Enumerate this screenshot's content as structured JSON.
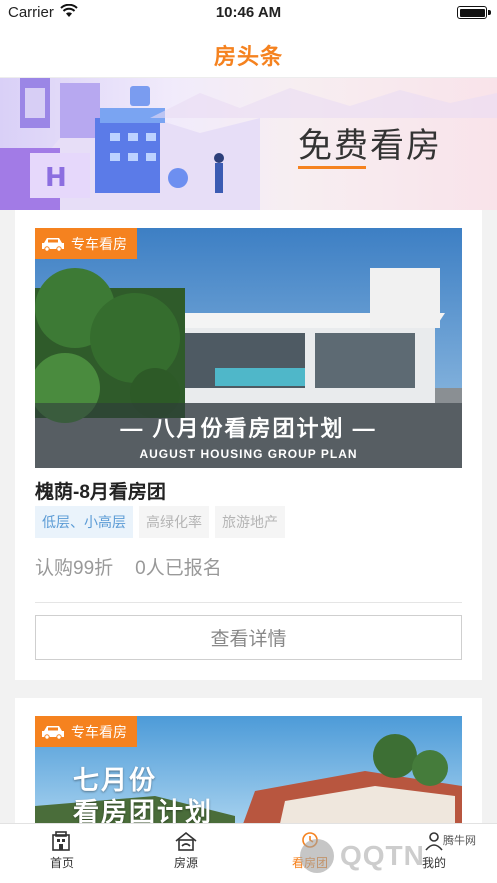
{
  "status": {
    "carrier": "Carrier",
    "time": "10:46 AM"
  },
  "nav": {
    "title": "房头条"
  },
  "banner": {
    "title": "免费看房"
  },
  "cards": [
    {
      "badge": "专车看房",
      "image_caption_cn": "— 八月份看房团计划 —",
      "image_caption_en": "AUGUST HOUSING GROUP PLAN",
      "title": "槐荫-8月看房团",
      "tags": [
        "低层、小高层",
        "高绿化率",
        "旅游地产"
      ],
      "discount": "认购99折",
      "signups": "0人已报名",
      "button": "查看详情"
    },
    {
      "badge": "专车看房",
      "image_caption_line1": "七月份",
      "image_caption_line2": "看房团计划"
    }
  ],
  "tabs": [
    {
      "label": "首页",
      "icon": "home-icon"
    },
    {
      "label": "房源",
      "icon": "house-source-icon"
    },
    {
      "label": "看房团",
      "icon": "tour-icon"
    },
    {
      "label": "我的",
      "icon": "profile-icon"
    }
  ],
  "watermark": {
    "text": "QQTN",
    "small": "腾牛网"
  },
  "colors": {
    "accent": "#f5821f",
    "tag_blue": "#5b9bd5"
  }
}
